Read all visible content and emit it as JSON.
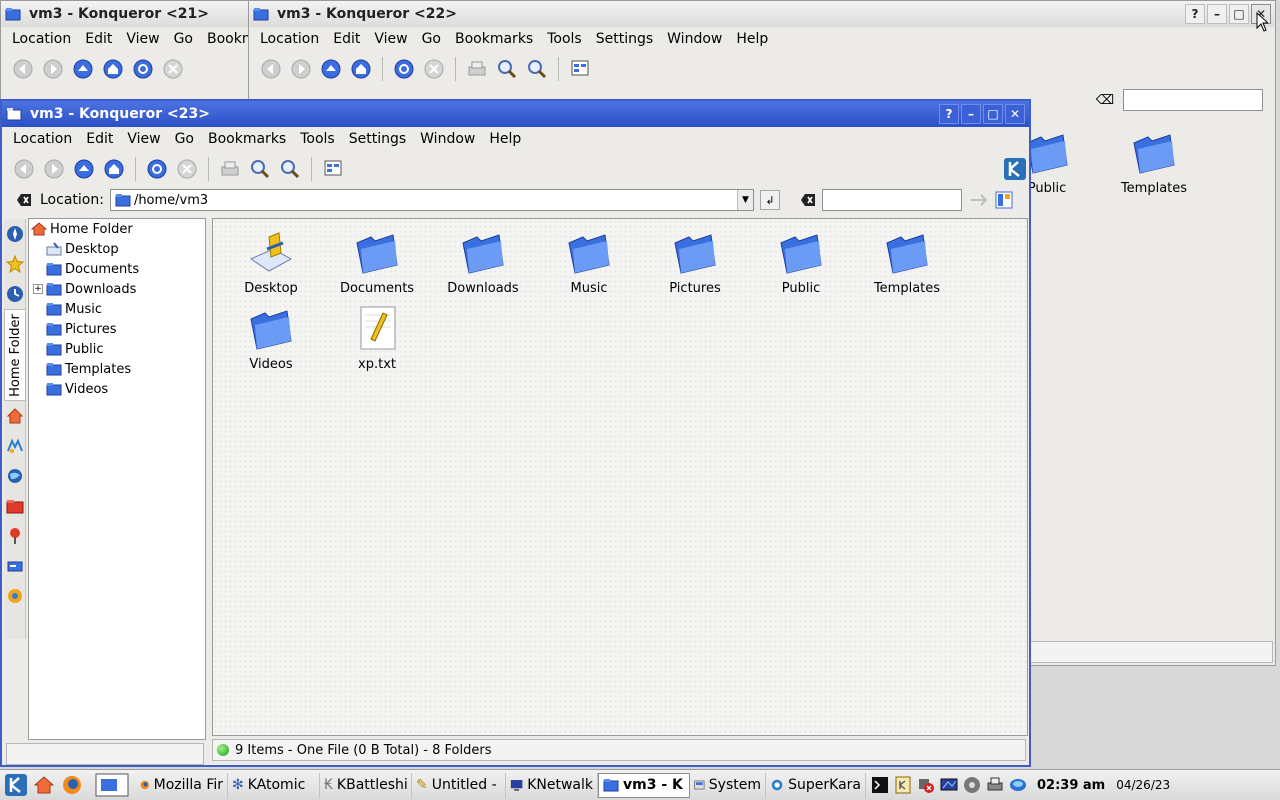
{
  "colors": {
    "accent": "#3f5dc9",
    "folder": "#3a6fe0",
    "taskbar": "#e6e6e6"
  },
  "menu_items": [
    "Location",
    "Edit",
    "View",
    "Go",
    "Bookmarks",
    "Tools",
    "Settings",
    "Window",
    "Help"
  ],
  "window21": {
    "title": "vm3 - Konqueror <21>",
    "menu": [
      "Location",
      "Edit",
      "View",
      "Go",
      "Bookm"
    ]
  },
  "window22": {
    "title": "vm3 - Konqueror <22>",
    "visible_files": [
      "Public",
      "Templates"
    ]
  },
  "window23": {
    "title": "vm3 - Konqueror <23>",
    "location_label": "Location:",
    "location_value": "/home/vm3",
    "sidebar_tab": "Home Folder",
    "tree": {
      "root": "Home Folder",
      "children": [
        "Desktop",
        "Documents",
        "Downloads",
        "Music",
        "Pictures",
        "Public",
        "Templates",
        "Videos"
      ]
    },
    "files": [
      "Desktop",
      "Documents",
      "Downloads",
      "Music",
      "Pictures",
      "Public",
      "Templates",
      "Videos",
      "xp.txt"
    ],
    "status": "9 Items - One File (0 B Total) - 8 Folders"
  },
  "title_buttons": {
    "help": "?",
    "minimize": "–",
    "maximize": "□",
    "close": "✕"
  },
  "taskbar": {
    "tasks": [
      "Mozilla Fir",
      "KAtomic",
      "KBattleshi",
      "Untitled - ",
      "KNetwalk",
      "vm3 - K",
      "System",
      "SuperKara"
    ],
    "clock": "02:39 am",
    "date": "04/26/23"
  }
}
